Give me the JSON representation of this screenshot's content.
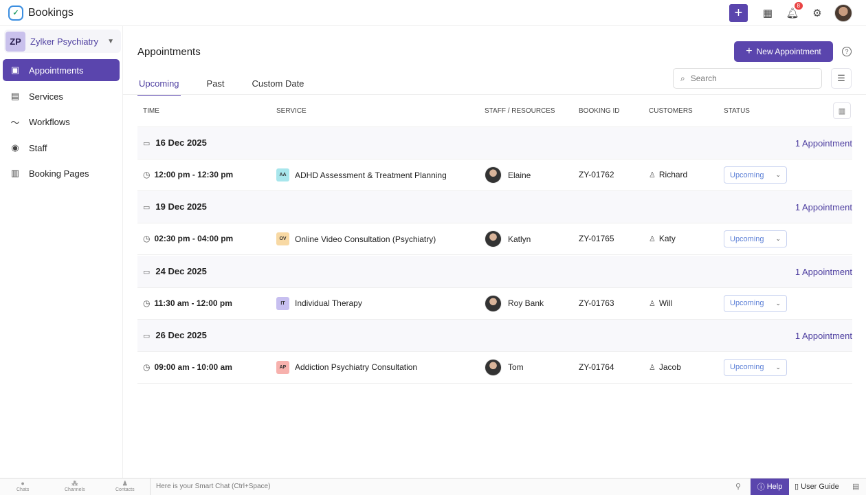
{
  "app": {
    "title": "Bookings",
    "notification_count": "8"
  },
  "org": {
    "initials": "ZP",
    "name": "Zylker Psychiatry"
  },
  "sidebar": {
    "items": [
      {
        "label": "Appointments",
        "icon": "calendar-icon"
      },
      {
        "label": "Services",
        "icon": "clipboard-icon"
      },
      {
        "label": "Workflows",
        "icon": "workflow-icon"
      },
      {
        "label": "Staff",
        "icon": "user-icon"
      },
      {
        "label": "Booking Pages",
        "icon": "layout-icon"
      }
    ]
  },
  "header": {
    "title": "Appointments",
    "new_button": "New Appointment",
    "search_placeholder": "Search"
  },
  "tabs": [
    {
      "label": "Upcoming"
    },
    {
      "label": "Past"
    },
    {
      "label": "Custom Date"
    }
  ],
  "columns": [
    "TIME",
    "SERVICE",
    "STAFF / RESOURCES",
    "BOOKING ID",
    "CUSTOMERS",
    "STATUS"
  ],
  "groups": [
    {
      "date": "16 Dec 2025",
      "count": "1 Appointment",
      "appt": {
        "time": "12:00 pm - 12:30 pm",
        "badge": "AA",
        "badge_color": "#a8e6ec",
        "service": "ADHD Assessment & Treatment Planning",
        "staff": "Elaine",
        "booking_id": "ZY-01762",
        "customer": "Richard",
        "status": "Upcoming"
      }
    },
    {
      "date": "19 Dec 2025",
      "count": "1 Appointment",
      "appt": {
        "time": "02:30 pm - 04:00 pm",
        "badge": "OV",
        "badge_color": "#f8d9a4",
        "service": "Online Video Consultation (Psychiatry)",
        "staff": "Katlyn",
        "booking_id": "ZY-01765",
        "customer": "Katy",
        "status": "Upcoming"
      }
    },
    {
      "date": "24 Dec 2025",
      "count": "1 Appointment",
      "appt": {
        "time": "11:30 am - 12:00 pm",
        "badge": "IT",
        "badge_color": "#c7bff0",
        "service": "Individual Therapy",
        "staff": "Roy Bank",
        "booking_id": "ZY-01763",
        "customer": "Will",
        "status": "Upcoming"
      }
    },
    {
      "date": "26 Dec 2025",
      "count": "1 Appointment",
      "appt": {
        "time": "09:00 am - 10:00 am",
        "badge": "AP",
        "badge_color": "#f7b1ad",
        "service": "Addiction Psychiatry Consultation",
        "staff": "Tom",
        "booking_id": "ZY-01764",
        "customer": "Jacob",
        "status": "Upcoming"
      }
    }
  ],
  "bottom": {
    "chats": "Chats",
    "channels": "Channels",
    "contacts": "Contacts",
    "smart_chat": "Here is your Smart Chat (Ctrl+Space)",
    "help": "Help",
    "guide": "User Guide"
  }
}
